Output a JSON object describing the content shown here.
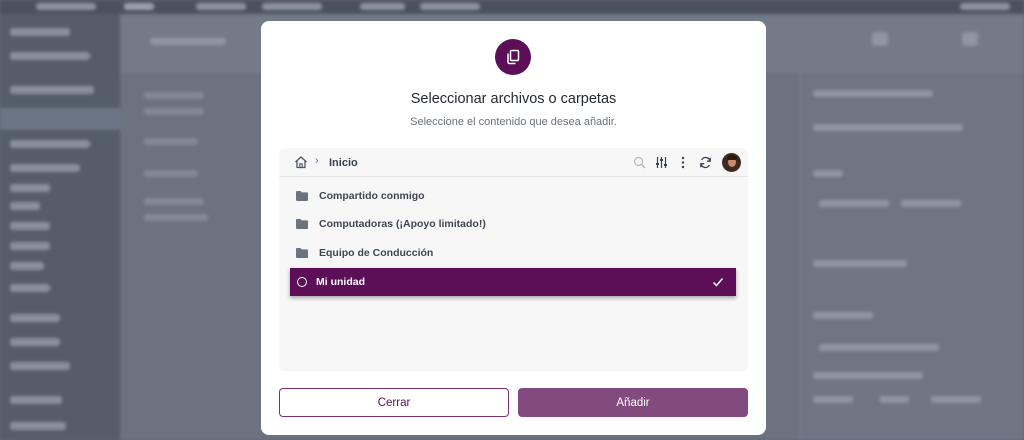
{
  "modal": {
    "title": "Seleccionar archivos o carpetas",
    "subtitle": "Seleccione el contenido que desea añadir."
  },
  "picker": {
    "breadcrumb": {
      "separator": "›",
      "current": "Inicio"
    },
    "toolbar_icons": [
      "search-icon",
      "filter-sliders-icon",
      "more-vertical-icon",
      "refresh-icon"
    ],
    "items": [
      {
        "label": "Compartido conmigo",
        "icon": "folder-icon",
        "selected": false
      },
      {
        "label": "Computadoras (¡Apoyo limitado!)",
        "icon": "folder-icon",
        "selected": false
      },
      {
        "label": "Equipo de Conducción",
        "icon": "folder-icon",
        "selected": false
      },
      {
        "label": "Mi unidad",
        "icon": "radio-icon",
        "selected": true
      }
    ]
  },
  "buttons": {
    "close_label": "Cerrar",
    "add_label": "Añadir"
  },
  "colors": {
    "accent": "#5c0e57",
    "add_button": "#834a80",
    "overlay": "#5f6776"
  }
}
